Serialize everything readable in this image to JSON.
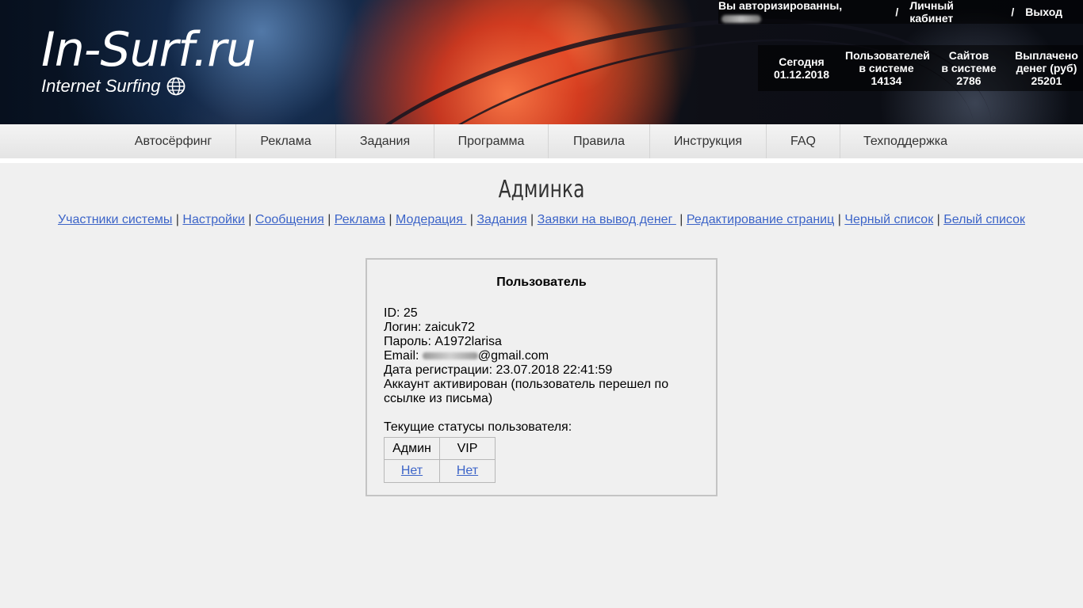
{
  "header": {
    "logo": "In-Surf.ru",
    "tagline": "Internet Surfing",
    "auth_text": "Вы авторизированны,",
    "cabinet_link": "Личный кабинет",
    "logout_link": "Выход",
    "separator": "/",
    "stats": [
      {
        "label1": "Сегодня",
        "label2": "",
        "value": "01.12.2018"
      },
      {
        "label1": "Пользователей",
        "label2": "в системе",
        "value": "14134"
      },
      {
        "label1": "Сайтов",
        "label2": "в системе",
        "value": "2786"
      },
      {
        "label1": "Выплачено",
        "label2": "денег (руб)",
        "value": "25201"
      }
    ]
  },
  "nav": {
    "items": [
      "Автосёрфинг",
      "Реклама",
      "Задания",
      "Программа",
      "Правила",
      "Инструкция",
      "FAQ",
      "Техподдержка"
    ]
  },
  "page": {
    "title": "Админка",
    "admin_links": [
      "Участники системы",
      "Настройки",
      "Сообщения",
      "Реклама",
      "Модерация ",
      "Задания",
      "Заявки на вывод денег ",
      "Редактирование страниц",
      "Черный список",
      "Белый список"
    ],
    "link_separator": " | "
  },
  "user_card": {
    "title": "Пользователь",
    "id_line": "ID: 25",
    "login_line": "Логин: zaicuk72",
    "password_line": "Пароль: A1972larisa",
    "email_label": "Email: ",
    "email_suffix": "@gmail.com",
    "reg_line": "Дата регистрации: 23.07.2018 22:41:59",
    "activated_line": "Аккаунт активирован (пользователь перешел по ссылке из письма)",
    "statuses_label": "Текущие статусы пользователя:",
    "status_headers": [
      "Админ",
      "VIP"
    ],
    "status_values": [
      "Нет",
      "Нет"
    ]
  }
}
